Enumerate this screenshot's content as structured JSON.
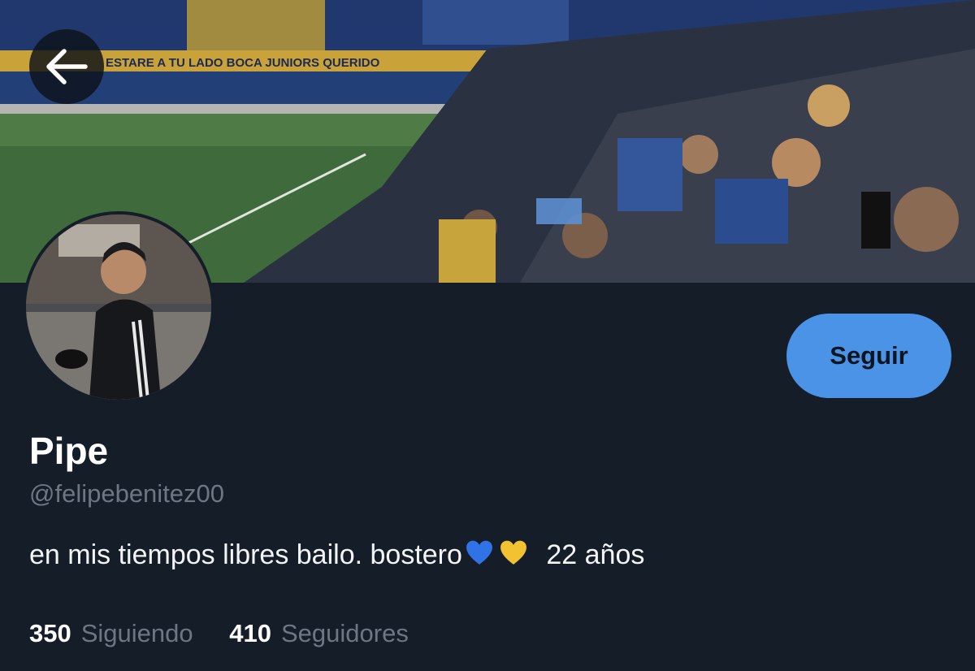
{
  "profile": {
    "display_name": "Pipe",
    "handle": "@felipebenitez00",
    "bio": {
      "text": "en mis tiempos libres bailo. bostero",
      "emoji": [
        "blue-heart",
        "yellow-heart"
      ],
      "age": "22 años"
    },
    "follow_button_label": "Seguir",
    "stats": {
      "following_count": "350",
      "following_label": "Siguiendo",
      "followers_count": "410",
      "followers_label": "Seguidores"
    }
  },
  "banner": {
    "stadium_banner_text": "ESTARE A TU LADO BOCA JUNIORS QUERIDO"
  },
  "colors": {
    "background": "#151d28",
    "accent_button": "#4a93e6",
    "secondary_text": "#6d7784"
  },
  "icons": {
    "back": "arrow-left-icon"
  }
}
